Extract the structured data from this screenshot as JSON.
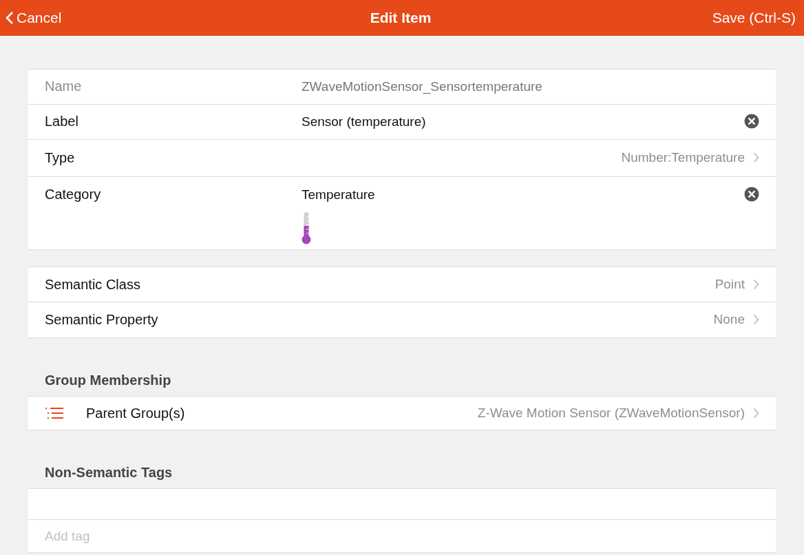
{
  "header": {
    "back": "Cancel",
    "title": "Edit Item",
    "save": "Save (Ctrl-S)"
  },
  "fields": [
    {
      "kind": "input",
      "label": "Name",
      "value": "ZWaveMotionSensor_Sensortemperature",
      "readonly": true
    },
    {
      "kind": "input",
      "label": "Label",
      "value": "Sensor (temperature)",
      "readonly": false
    },
    {
      "kind": "link",
      "label": "Type",
      "value": "Number:Temperature"
    },
    {
      "kind": "category",
      "label": "Category",
      "value": "Temperature",
      "readonly": false
    }
  ],
  "semantics": [
    {
      "label": "Semantic Class",
      "value": "Point"
    },
    {
      "label": "Semantic Property",
      "value": "None"
    }
  ],
  "group_membership": {
    "title": "Group Membership",
    "label": "Parent Group(s)",
    "value": "Z-Wave Motion Sensor (ZWaveMotionSensor)"
  },
  "tags": {
    "title": "Non-Semantic Tags",
    "placeholder": "Add tag"
  }
}
